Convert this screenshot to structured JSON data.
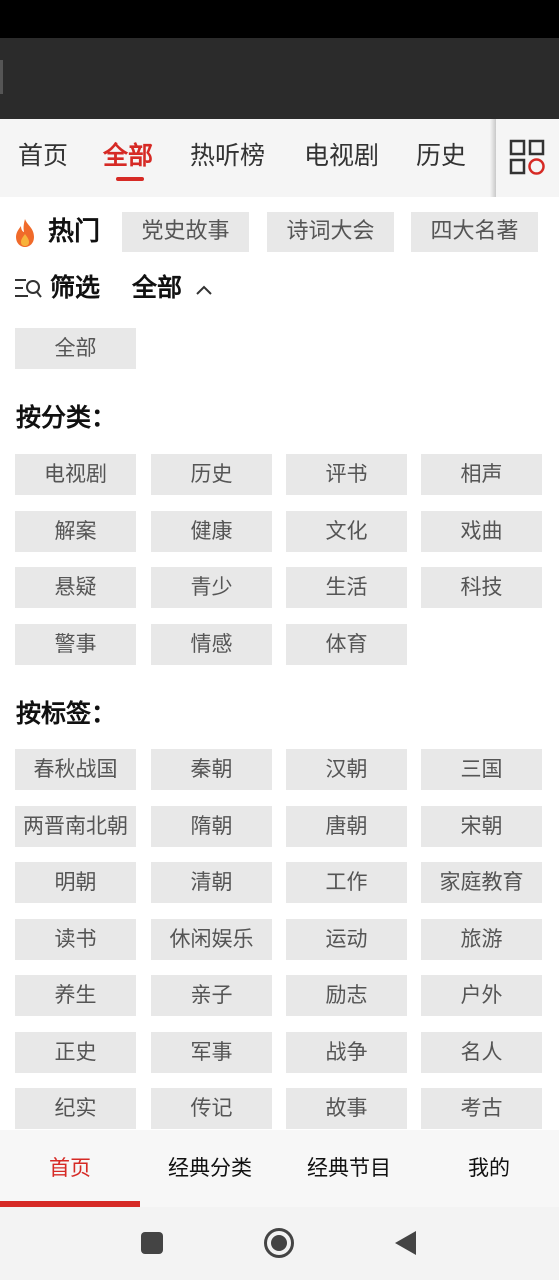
{
  "top_tabs": [
    {
      "label": "首页",
      "active": false
    },
    {
      "label": "全部",
      "active": true
    },
    {
      "label": "热听榜",
      "active": false
    },
    {
      "label": "电视剧",
      "active": false
    },
    {
      "label": "历史",
      "active": false
    }
  ],
  "hot": {
    "title": "热门",
    "tags": [
      "党史故事",
      "诗词大会",
      "四大名著"
    ]
  },
  "filter": {
    "label": "筛选",
    "value": "全部",
    "all_chip": "全部"
  },
  "by_category": {
    "heading": "按分类：",
    "items": [
      "电视剧",
      "历史",
      "评书",
      "相声",
      "解案",
      "健康",
      "文化",
      "戏曲",
      "悬疑",
      "青少",
      "生活",
      "科技",
      "警事",
      "情感",
      "体育"
    ]
  },
  "by_tag": {
    "heading": "按标签：",
    "items": [
      "春秋战国",
      "秦朝",
      "汉朝",
      "三国",
      "两晋南北朝",
      "隋朝",
      "唐朝",
      "宋朝",
      "明朝",
      "清朝",
      "工作",
      "家庭教育",
      "读书",
      "休闲娱乐",
      "运动",
      "旅游",
      "养生",
      "亲子",
      "励志",
      "户外",
      "正史",
      "军事",
      "战争",
      "名人",
      "纪实",
      "传记",
      "故事",
      "考古"
    ]
  },
  "bottom_nav": [
    {
      "label": "首页",
      "active": true
    },
    {
      "label": "经典分类",
      "active": false
    },
    {
      "label": "经典节目",
      "active": false
    },
    {
      "label": "我的",
      "active": false
    }
  ],
  "colors": {
    "accent": "#d62a25",
    "chip_bg": "#e8e8e8",
    "header_bg": "#2b2b2b"
  },
  "icons": {
    "hot": "flame-icon",
    "filter": "filter-search-icon",
    "expand": "chevron-up-icon",
    "grid": "category-grid-icon",
    "sys_back": "back-triangle-icon",
    "sys_home": "home-circle-icon",
    "sys_recent": "recent-square-icon"
  }
}
